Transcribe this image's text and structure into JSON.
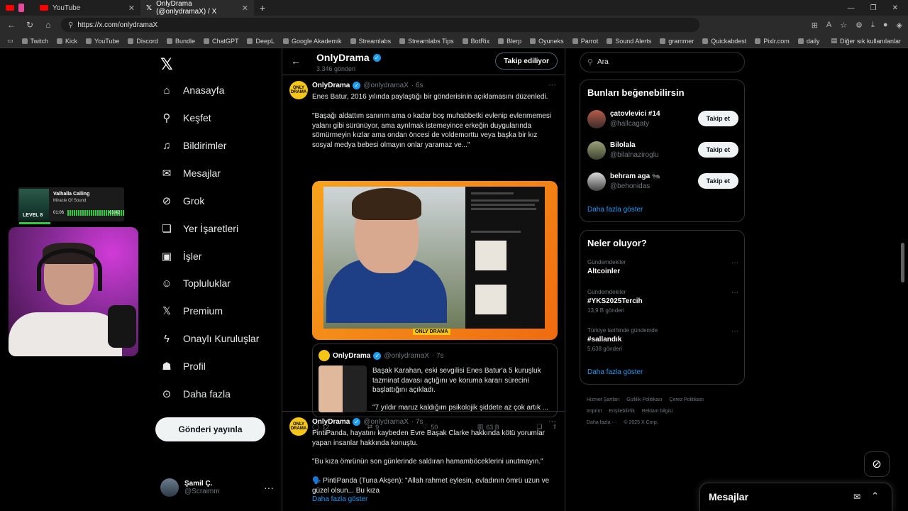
{
  "browser": {
    "tabs": [
      {
        "label": "YouTube"
      },
      {
        "label": "OnlyDrama (@onlydramaX) / X"
      }
    ],
    "url": "https://x.com/onlydramaX",
    "bookmarks": [
      "Twitch",
      "Kick",
      "YouTube",
      "Discord",
      "Bundle",
      "ChatGPT",
      "DeepL",
      "Google Akademik",
      "Streamlabs",
      "Streamlabs Tips",
      "BotRix",
      "Blerp",
      "Oyuneks",
      "Parrot",
      "Sound Alerts",
      "grammer",
      "Quickabdest",
      "Pixlr.com",
      "daily"
    ],
    "other_bookmarks": "Diğer sık kullanılanlar"
  },
  "music_overlay": {
    "title": "Valhalla Calling",
    "artist": "Miracle Of Sound",
    "cover_text": "LEVEL 8",
    "time_current": "01:06",
    "time_total": "03:42",
    "progress": 0.3
  },
  "nav": {
    "items": [
      {
        "label": "Anasayfa"
      },
      {
        "label": "Keşfet"
      },
      {
        "label": "Bildirimler"
      },
      {
        "label": "Mesajlar"
      },
      {
        "label": "Grok"
      },
      {
        "label": "Yer İşaretleri"
      },
      {
        "label": "İşler"
      },
      {
        "label": "Topluluklar"
      },
      {
        "label": "Premium"
      },
      {
        "label": "Onaylı Kuruluşlar"
      },
      {
        "label": "Profil"
      },
      {
        "label": "Daha fazla"
      }
    ],
    "post_button": "Gönderi yayınla",
    "user_name": "Şamil Ç.",
    "user_handle": "@Scraimm"
  },
  "profile_header": {
    "name": "OnlyDrama",
    "post_count": "3.346 gönderi",
    "follow_state": "Takip ediliyor"
  },
  "posts": [
    {
      "name": "OnlyDrama",
      "handle": "@onlydramaX",
      "time": "· 6s",
      "text1": "Enes Batur, 2016 yılında paylaştığı bir gönderisinin açıklamasını düzenledi.",
      "text2": "\"Başağı aldattım sanırım ama o kadar boş muhabbetki evlenip evlenmemesi yalanı gibi sürünüyor, ama ayrılmak istemeyince erkeğin duygularında sömürmeyin kızlar ama ondan öncesi de voldemorttu veya başka bir kız sosyal medya bebesi olmayın onlar yaramaz ve...\"",
      "media_watermark": "ONLY DRAMA",
      "quote": {
        "name": "OnlyDrama",
        "handle": "@onlydramaX",
        "time": "· 7s",
        "text1": "Başak Karahan, eski sevgilisi Enes Batur'a 5 kuruşluk tazminat davası açtığını ve koruma kararı sürecini başlattığını açıkladı.",
        "text2": "\"7 yıldır maruz kaldığım psikolojik şiddete az çok artık ..."
      },
      "replies": "12",
      "reposts": "9",
      "likes": "50",
      "views": "63 B"
    },
    {
      "name": "OnlyDrama",
      "handle": "@onlydramaX",
      "time": "· 7s",
      "text1": "PintiPanda, hayatını kaybeden Evre Başak Clarke hakkında kötü yorumlar yapan insanlar hakkında konuştu.",
      "text2": "\"Bu kıza ömrünün son günlerinde saldıran  hamamböceklerini unutmayın.\"",
      "text3": "🗣️ PintiPanda (Tuna Akşen): \"Allah rahmet eylesin, evladının ömrü uzun ve güzel olsun...  Bu kıza",
      "show_more": "Daha fazla göster"
    }
  ],
  "right": {
    "search_placeholder": "Ara",
    "suggestions_title": "Bunları beğenebilirsin",
    "suggestions": [
      {
        "name": "çatovlevici #14",
        "handle": "@hallcagaty",
        "button": "Takip et"
      },
      {
        "name": "Bilolala",
        "handle": "@bilalnaziroglu",
        "button": "Takip et"
      },
      {
        "name": "behram aga 🐜",
        "handle": "@behonidas",
        "button": "Takip et"
      }
    ],
    "suggestions_more": "Daha fazla göster",
    "trends_title": "Neler oluyor?",
    "trends": [
      {
        "category": "Gündemdekiler",
        "title": "Altcoinler",
        "count": ""
      },
      {
        "category": "Gündemdekiler",
        "title": "#YKS2025Tercih",
        "count": "13,9 B gönderi"
      },
      {
        "category": "Türkiye tarihinde gündemde",
        "title": "#sallandık",
        "count": "5.638 gönderi"
      }
    ],
    "trends_more": "Daha fazla göster",
    "footer": [
      "Hizmet Şartları",
      "Gizlilik Politikası",
      "Çerez Politikası",
      "Imprint",
      "Erişilebilirlik",
      "Reklam bilgisi",
      "Daha fazla ···",
      "© 2025 X Corp."
    ]
  },
  "dm_drawer": {
    "title": "Mesajlar"
  }
}
